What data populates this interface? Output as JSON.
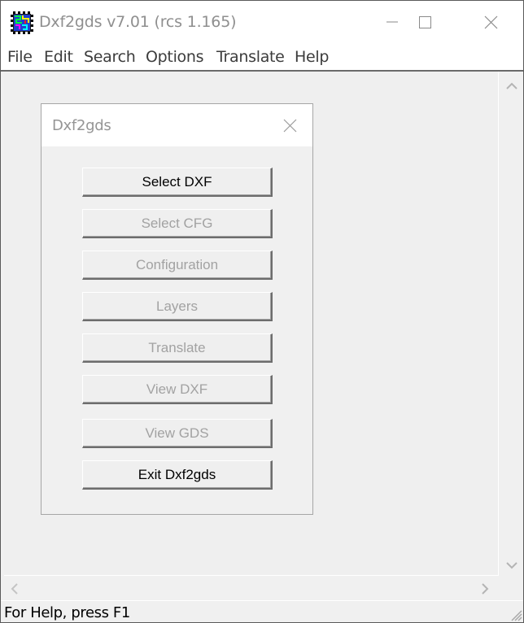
{
  "window": {
    "title": "Dxf2gds v7.01 (rcs 1.165)",
    "app_icon": "dxf2gds-chip-icon",
    "caption_buttons": [
      "minimize",
      "maximize",
      "close"
    ]
  },
  "menubar": {
    "items": [
      {
        "label": "File"
      },
      {
        "label": "Edit"
      },
      {
        "label": "Search"
      },
      {
        "label": "Options"
      },
      {
        "label": "Translate"
      },
      {
        "label": "Help"
      }
    ]
  },
  "dialog": {
    "title": "Dxf2gds",
    "close_icon": "close-icon",
    "buttons": [
      {
        "label": "Select DXF",
        "enabled": true
      },
      {
        "label": "Select CFG",
        "enabled": false
      },
      {
        "label": "Configuration",
        "enabled": false
      },
      {
        "label": "Layers",
        "enabled": false
      },
      {
        "label": "Translate",
        "enabled": false
      },
      {
        "label": "View DXF",
        "enabled": false
      },
      {
        "label": "View GDS",
        "enabled": false
      },
      {
        "label": "Exit Dxf2gds",
        "enabled": true
      }
    ]
  },
  "scrollbars": {
    "vertical": {
      "up_icon": "chevron-up-icon",
      "down_icon": "chevron-down-icon"
    },
    "horizontal": {
      "left_icon": "chevron-left-icon",
      "right_icon": "chevron-right-icon"
    }
  },
  "statusbar": {
    "text": "For Help, press F1"
  },
  "colors": {
    "client_bg": "#f0f0f0",
    "disabled_text": "#a2a2a2",
    "enabled_text": "#000000",
    "title_text_inactive": "#8f8f8f"
  }
}
